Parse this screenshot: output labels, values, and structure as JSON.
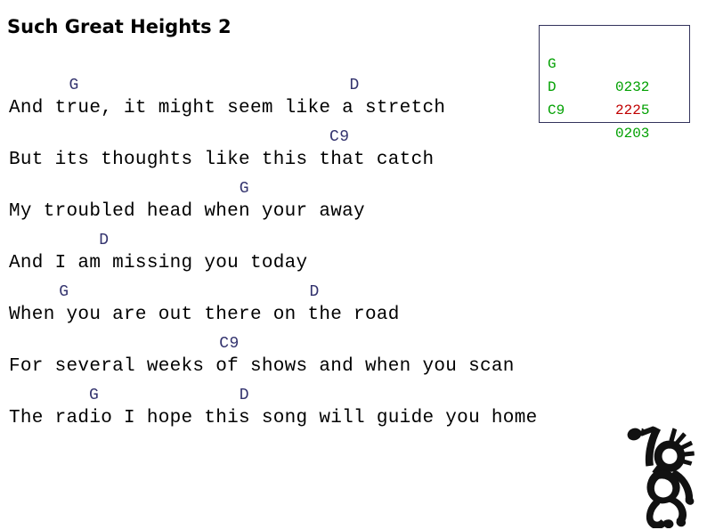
{
  "slide": {
    "title": "Such Great Heights 2",
    "background_color": "#ffffff"
  },
  "colors": {
    "chord_inline": "#33336e",
    "chord_box_border": "#33335c",
    "chord_name_green": "#00a000",
    "fret_red": "#c00000",
    "lyric_black": "#000000"
  },
  "chord_box": {
    "rows": [
      {
        "name": "G",
        "frets": "0232",
        "frets_red_part": "",
        "frets_green_part": "0232"
      },
      {
        "name": "D",
        "frets": "2225",
        "frets_red_part": "222",
        "frets_green_part": "5"
      },
      {
        "name": "C9",
        "frets": "0203",
        "frets_red_part": "",
        "frets_green_part": "0203"
      }
    ]
  },
  "lyrics": {
    "lines": [
      {
        "chords": "      G                           D",
        "text": "And true, it might seem like a stretch"
      },
      {
        "chords": "                                C9",
        "text": "But its thoughts like this that catch"
      },
      {
        "chords": "                       G",
        "text": "My troubled head when your away"
      },
      {
        "chords": "         D",
        "text": "And I am missing you today"
      },
      {
        "chords": "     G                        D",
        "text": "When you are out there on the road"
      },
      {
        "chords": "                     C9",
        "text": "For several weeks of shows and when you scan"
      },
      {
        "chords": "        G              D",
        "text": "The radio I hope this song will guide you home"
      }
    ]
  },
  "graphic": {
    "name": "kokopelli-dancer",
    "color": "#111111"
  }
}
